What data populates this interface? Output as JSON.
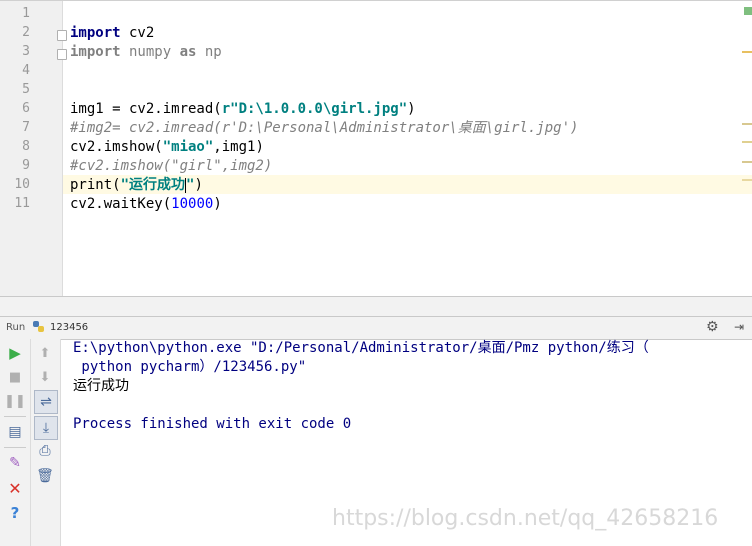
{
  "editor": {
    "line_numbers": [
      "1",
      "2",
      "3",
      "4",
      "5",
      "6",
      "7",
      "8",
      "9",
      "10",
      "11"
    ],
    "line2": {
      "kw": "import",
      "rest": " cv2"
    },
    "line3": {
      "kw": "import",
      "mod": " numpy ",
      "as": "as",
      "alias": " np"
    },
    "line6": {
      "pre": "img1 = cv2.imread(",
      "str": "r\"D:\\1.0.0.0\\girl.jpg\"",
      "post": ")"
    },
    "line7": "#img2= cv2.imread(r'D:\\Personal\\Administrator\\桌面\\girl.jpg')",
    "line8": {
      "pre": "cv2.imshow(",
      "str": "\"miao\"",
      "post": ",img1)"
    },
    "line9": "#cv2.imshow(\"girl\",img2)",
    "line10": {
      "pre": "print(",
      "str_a": "\"运行成功",
      "str_b": "\"",
      "post": ")"
    },
    "line11": {
      "pre": "cv2.waitKey(",
      "num": "10000",
      "post": ")"
    }
  },
  "run_bar": {
    "tab_label": "Run",
    "config_name": "123456"
  },
  "console": {
    "command_line1": "E:\\python\\python.exe \"D:/Personal/Administrator/桌面/Pmz python/练习（",
    "command_line2": " python pycharm）/123456.py\"",
    "output": "运行成功",
    "exit_message": "Process finished with exit code 0"
  },
  "watermark": "https://blog.csdn.net/qq_42658216",
  "colors": {
    "keyword": "#000080",
    "string": "#008080",
    "number": "#0000ff",
    "comment": "#808080",
    "current_line": "#fffae3",
    "run_green": "#3cae4a"
  }
}
